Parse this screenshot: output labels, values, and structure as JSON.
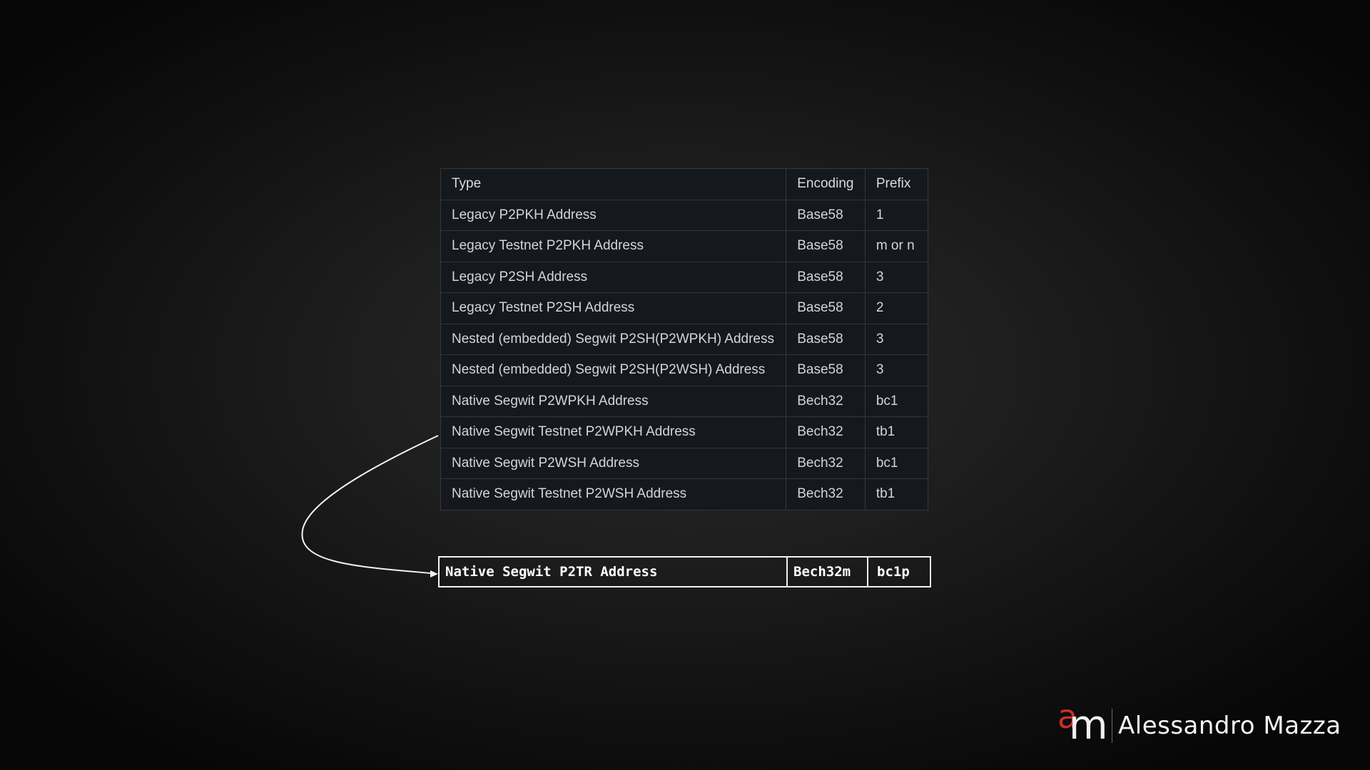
{
  "table": {
    "headers": {
      "type": "Type",
      "encoding": "Encoding",
      "prefix": "Prefix"
    },
    "rows": [
      {
        "type": "Legacy P2PKH Address",
        "encoding": "Base58",
        "prefix": "1"
      },
      {
        "type": "Legacy Testnet P2PKH Address",
        "encoding": "Base58",
        "prefix": "m or n"
      },
      {
        "type": "Legacy P2SH Address",
        "encoding": "Base58",
        "prefix": "3"
      },
      {
        "type": "Legacy Testnet P2SH Address",
        "encoding": "Base58",
        "prefix": "2"
      },
      {
        "type": "Nested (embedded) Segwit P2SH(P2WPKH) Address",
        "encoding": "Base58",
        "prefix": "3"
      },
      {
        "type": "Nested (embedded) Segwit P2SH(P2WSH) Address",
        "encoding": "Base58",
        "prefix": "3"
      },
      {
        "type": "Native Segwit P2WPKH Address",
        "encoding": "Bech32",
        "prefix": "bc1"
      },
      {
        "type": "Native Segwit Testnet P2WPKH Address",
        "encoding": "Bech32",
        "prefix": "tb1"
      },
      {
        "type": "Native Segwit P2WSH Address",
        "encoding": "Bech32",
        "prefix": "bc1"
      },
      {
        "type": "Native Segwit Testnet P2WSH Address",
        "encoding": "Bech32",
        "prefix": "tb1"
      }
    ]
  },
  "highlight_row": {
    "type": "Native Segwit P2TR Address",
    "encoding": "Bech32m",
    "prefix": "bc1p"
  },
  "brand": {
    "logo_letters": "am",
    "name": "Alessandro Mazza"
  },
  "colors": {
    "logo_accent": "#c8302c",
    "arrow": "#f2f2f2"
  }
}
